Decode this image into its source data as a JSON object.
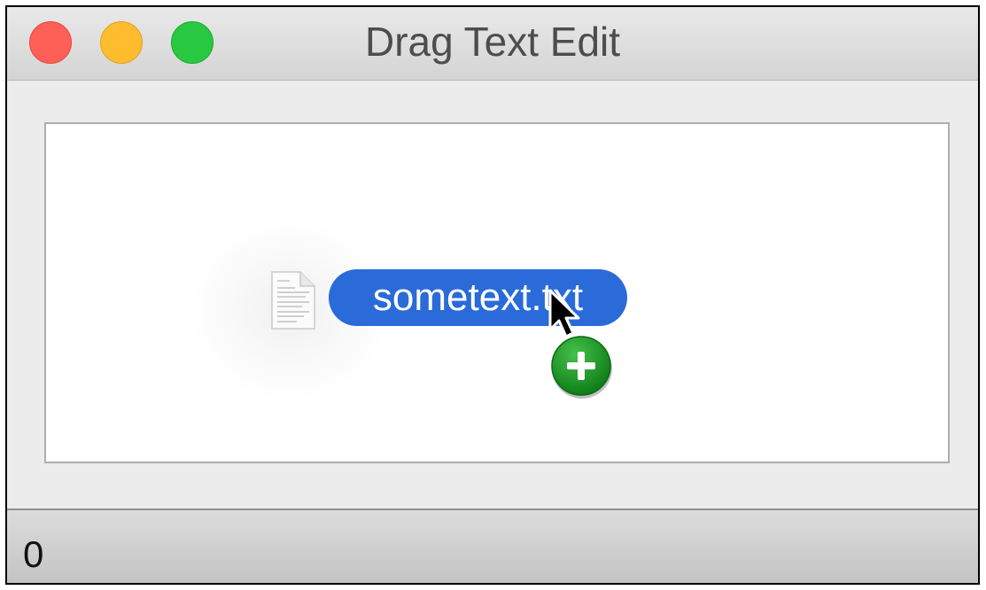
{
  "window": {
    "title": "Drag Text Edit",
    "buttons": [
      "close",
      "minimize",
      "zoom"
    ]
  },
  "drag": {
    "file_name": "sometext.txt",
    "file_icon": "document-icon",
    "badge_icon": "plus-icon",
    "pill_color": "#2a6bd9",
    "badge_color": "#1f9e2c"
  },
  "status": {
    "count": "0"
  }
}
